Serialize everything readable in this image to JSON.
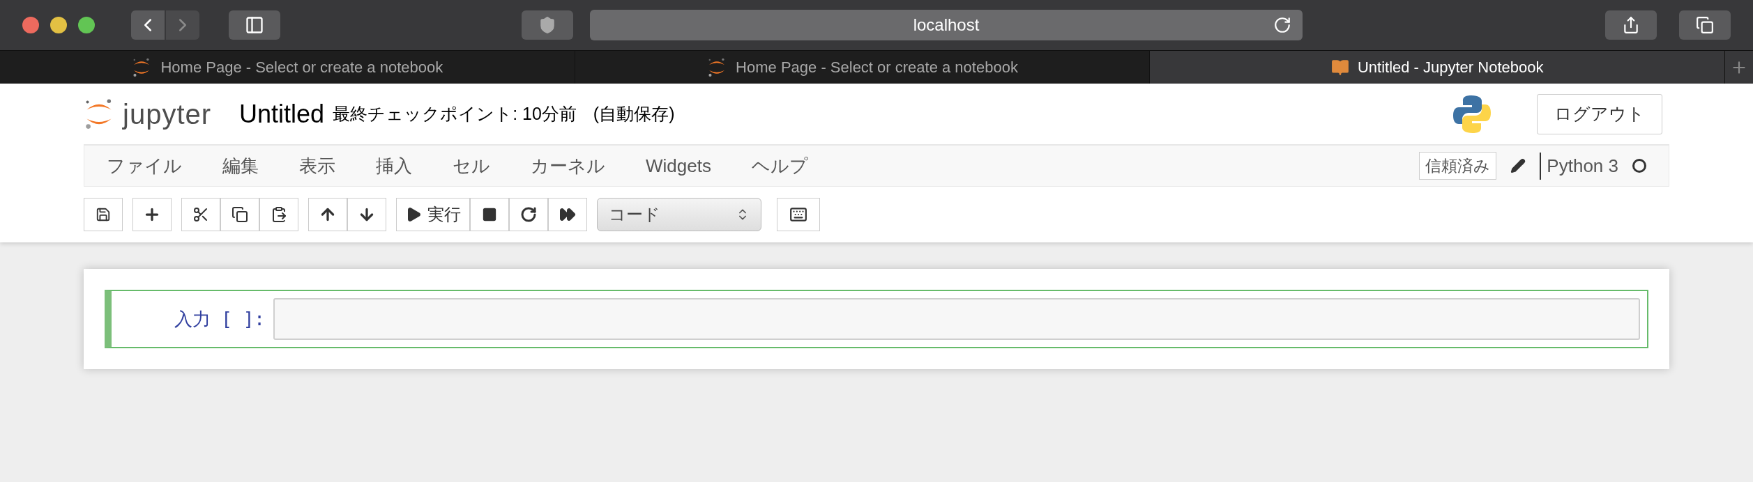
{
  "browser": {
    "address": "localhost",
    "tabs": [
      {
        "title": "Home Page - Select or create a notebook",
        "kind": "home",
        "selected": false
      },
      {
        "title": "Home Page - Select or create a notebook",
        "kind": "home",
        "selected": false
      },
      {
        "title": "Untitled - Jupyter Notebook",
        "kind": "notebook",
        "selected": true
      }
    ]
  },
  "header": {
    "logo_text": "jupyter",
    "notebook_name": "Untitled",
    "checkpoint": "最終チェックポイント: 10分前",
    "autosave": "(自動保存)",
    "logout": "ログアウト"
  },
  "menu": {
    "items": [
      "ファイル",
      "編集",
      "表示",
      "挿入",
      "セル",
      "カーネル",
      "Widgets",
      "ヘルプ"
    ],
    "trusted": "信頼済み",
    "kernel_name": "Python 3",
    "kernel_busy": false
  },
  "toolbar": {
    "run_label": "実行",
    "cell_type": "コード"
  },
  "cells": [
    {
      "prompt": "入力 [ ]:",
      "selected": true
    }
  ]
}
